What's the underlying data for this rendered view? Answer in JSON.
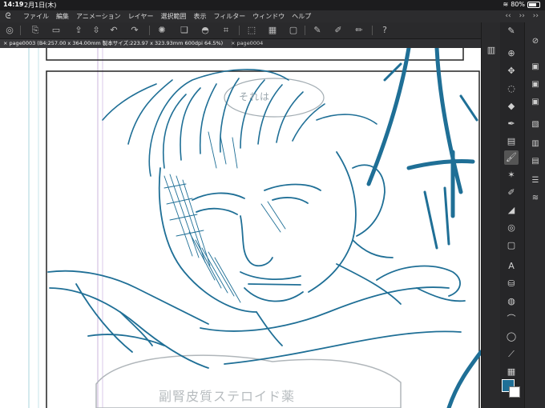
{
  "status": {
    "time": "14:19",
    "date": "2月1日(木)",
    "battery": "80%"
  },
  "menu": {
    "items": [
      "ファイル",
      "編集",
      "アニメーション",
      "レイヤー",
      "選択範囲",
      "表示",
      "フィルター",
      "ウィンドウ",
      "ヘルプ"
    ]
  },
  "tabs": [
    {
      "label": "page0003 (B4:257.00 x 364.00mm 製本サイズ:223.97 x 323.93mm 600dpi 64.5%)"
    },
    {
      "label": "page0004"
    }
  ],
  "canvas": {
    "balloon_text": "それは",
    "bottom_text": "副腎皮質ステロイド薬"
  },
  "colors": {
    "main": "#1f6f96",
    "sub": "#ffffff",
    "ink": "#1f6f96"
  },
  "icons": {
    "toolbar": [
      "settings-icon",
      "new-file-icon",
      "open-folder-icon",
      "save-icon",
      "undo-icon",
      "redo-icon",
      "loading-icon",
      "copy-icon",
      "fill-icon",
      "crop-icon",
      "transform-icon",
      "pen-stroke-icon",
      "brush-stroke-icon",
      "eraser-stroke-icon",
      "help-icon"
    ],
    "tools": [
      "zoom-icon",
      "move-icon",
      "lasso-icon",
      "eraser-icon",
      "pen-icon",
      "gradient-icon",
      "brush-active-icon",
      "sparkle-icon",
      "marker-icon",
      "figure-icon",
      "spiral-icon",
      "frame-icon",
      "text-icon",
      "fill-bucket-icon",
      "blend-icon",
      "airbrush-icon",
      "balloon-icon",
      "eyedropper-icon",
      "ruler-icon",
      "layer-panel-icon",
      "hand-icon"
    ]
  }
}
